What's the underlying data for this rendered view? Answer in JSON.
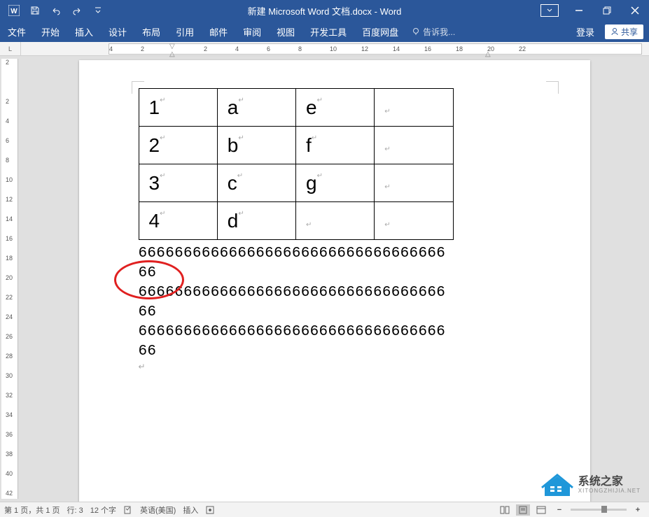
{
  "title": "新建 Microsoft Word 文档.docx - Word",
  "menus": {
    "file": "文件",
    "home": "开始",
    "insert": "插入",
    "design": "设计",
    "layout": "布局",
    "references": "引用",
    "mailings": "邮件",
    "review": "审阅",
    "view": "视图",
    "developer": "开发工具",
    "baidu": "百度网盘",
    "tellme": "告诉我...",
    "login": "登录",
    "share": "共享"
  },
  "ruler_corner": "L",
  "h_ruler_ticks": [
    "4",
    "2",
    "",
    "2",
    "4",
    "6",
    "8",
    "10",
    "12",
    "14",
    "16",
    "18",
    "20",
    "22"
  ],
  "v_ruler_ticks": [
    "2",
    "",
    "2",
    "4",
    "6",
    "8",
    "10",
    "12",
    "14",
    "16",
    "18",
    "20",
    "22",
    "24",
    "26",
    "28",
    "30",
    "32",
    "34",
    "36",
    "38",
    "40",
    "42"
  ],
  "table": {
    "rows": [
      [
        "1",
        "a",
        "e",
        ""
      ],
      [
        "2",
        "b",
        "f",
        ""
      ],
      [
        "3",
        "c",
        "g",
        ""
      ],
      [
        "4",
        "d",
        "",
        ""
      ]
    ]
  },
  "paragraphs": [
    "666666666666666666666666666666666666",
    "666666666666666666666666666666666666",
    "666666666666666666666666666666666666"
  ],
  "status": {
    "page": "第 1 页，共 1 页",
    "line": "行: 3",
    "chars": "12 个字",
    "lang": "英语(美国)",
    "insert": "插入",
    "zoom": "100%"
  },
  "watermark": {
    "brand": "系统之家",
    "sub": "XITONGZHIJIA.NET"
  },
  "icons": {
    "save": "save-icon",
    "undo": "undo-icon",
    "redo": "redo-icon",
    "customize": "chevron-down-icon",
    "ribbon": "ribbon-options-icon",
    "minimize": "minimize-icon",
    "restore": "restore-icon",
    "close": "close-icon",
    "bulb": "lightbulb-icon",
    "person": "person-icon"
  }
}
